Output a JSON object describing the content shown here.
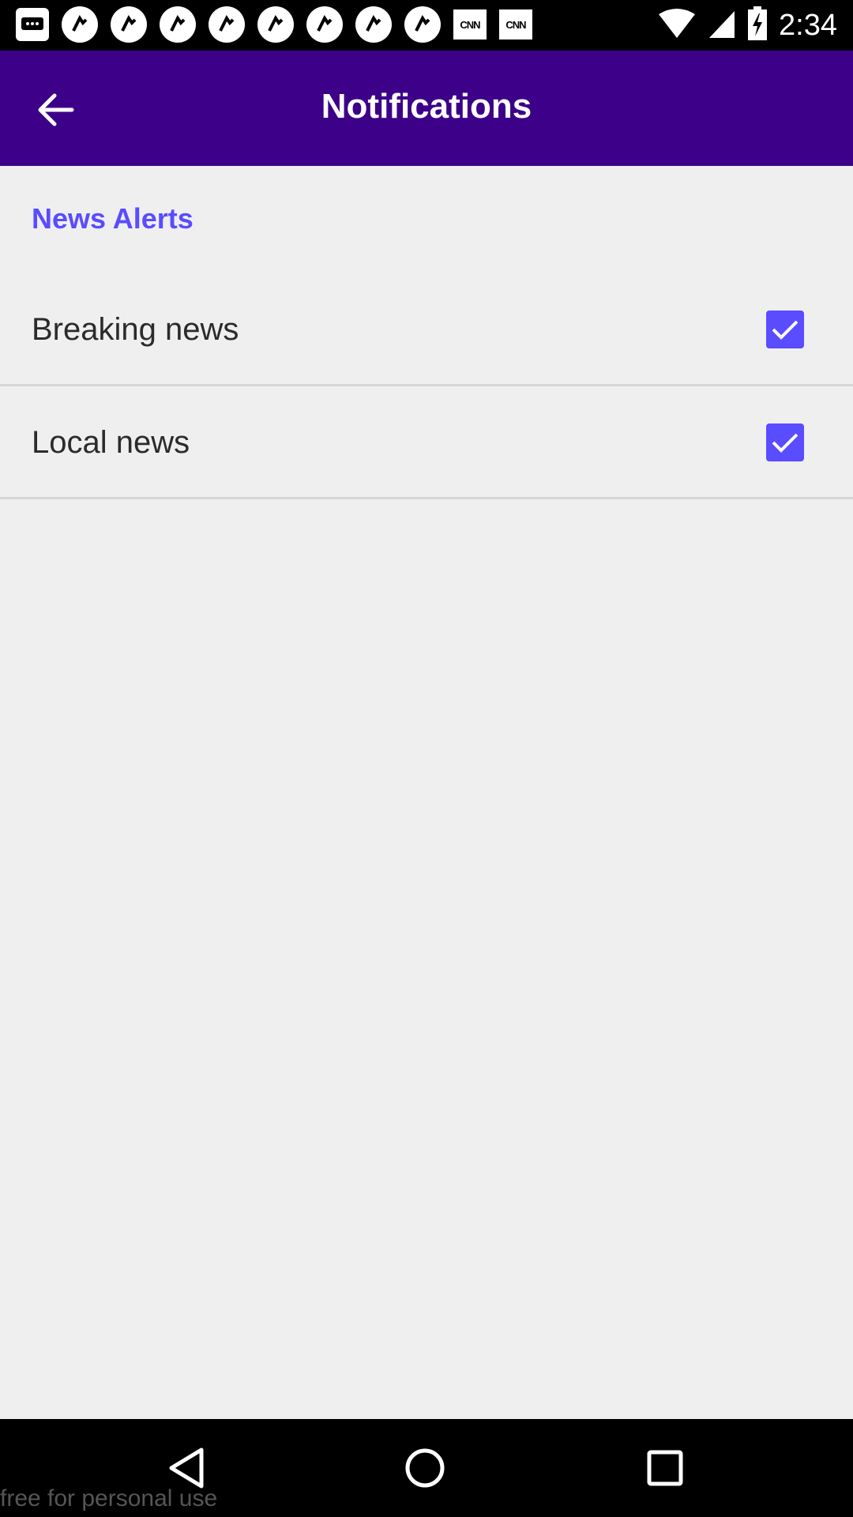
{
  "status_bar": {
    "time": "2:34",
    "notification_icons": [
      "message-icon",
      "app-icon",
      "app-icon",
      "app-icon",
      "app-icon",
      "app-icon",
      "app-icon",
      "app-icon",
      "app-icon",
      "app-icon"
    ],
    "cnn_label": "CNN"
  },
  "app_bar": {
    "title": "Notifications",
    "background": "#3d0088"
  },
  "section": {
    "title": "News Alerts",
    "accent": "#5a4cff"
  },
  "settings": [
    {
      "label": "Breaking news",
      "checked": true
    },
    {
      "label": "Local news",
      "checked": true
    }
  ],
  "watermark": "free for personal use"
}
